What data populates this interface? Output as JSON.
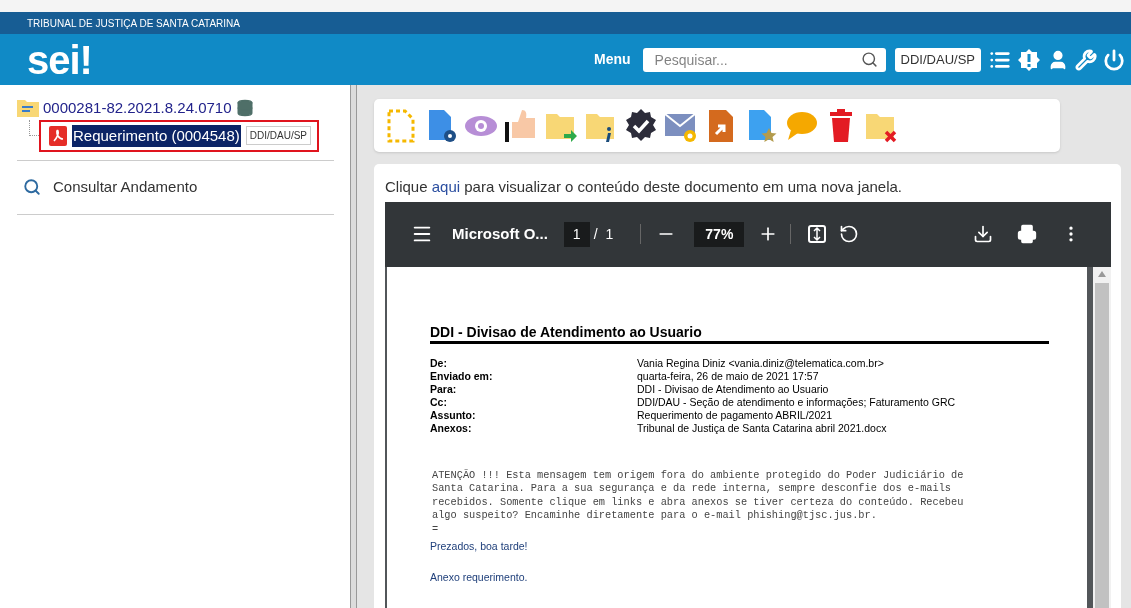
{
  "header": {
    "organization": "TRIBUNAL DE JUSTIÇA DE SANTA CATARINA",
    "logo": "sei!",
    "menu": "Menu",
    "search": {
      "placeholder": "Pesquisar..."
    },
    "unit": "DDI/DAU/SP"
  },
  "tree": {
    "process": "0000281-82.2021.8.24.0710",
    "children": [
      {
        "label": "Requerimento (0004548)",
        "tag": "DDI/DAU/SP",
        "selected": true,
        "outlined": true
      }
    ]
  },
  "sidebar_link": "Consultar Andamento",
  "content": {
    "notice_before": "Clique",
    "notice_link": "aqui",
    "notice_after": "para visualizar o conteúdo deste documento em uma nova janela."
  },
  "pdf_viewer": {
    "title": "Microsoft O...",
    "page": "1",
    "page_separator": "/",
    "page_count": "1",
    "zoom": "77%"
  },
  "document": {
    "heading": "DDI - Divisao de Atendimento ao Usuario",
    "fields": [
      {
        "label": "De:",
        "value": "Vania Regina Diniz <vania.diniz@telematica.com.br>"
      },
      {
        "label": "Enviado em:",
        "value": "quarta-feira, 26 de maio de 2021 17:57"
      },
      {
        "label": "Para:",
        "value": "DDI - Divisao de Atendimento ao Usuario"
      },
      {
        "label": "Cc:",
        "value": "DDI/DAU - Seção de atendimento e informações; Faturamento GRC"
      },
      {
        "label": "Assunto:",
        "value": "Requerimento de pagamento ABRIL/2021"
      },
      {
        "label": "Anexos:",
        "value": "Tribunal de Justiça de Santa Catarina abril 2021.docx"
      }
    ],
    "warning": "ATENÇÃO !!! Esta mensagem tem origem fora do ambiente protegido do Poder Judiciário de\nSanta Catarina. Para a sua segurança e da rede interna, sempre desconfie dos e-mails\nrecebidos. Somente clique em links e abra anexos se tiver certeza do conteúdo. Recebeu\nalgo suspeito? Encaminhe diretamente para o e-mail phishing@tjsc.jus.br.",
    "separator": "=",
    "greeting": "Prezados, boa tarde!",
    "body": "Anexo requerimento."
  }
}
